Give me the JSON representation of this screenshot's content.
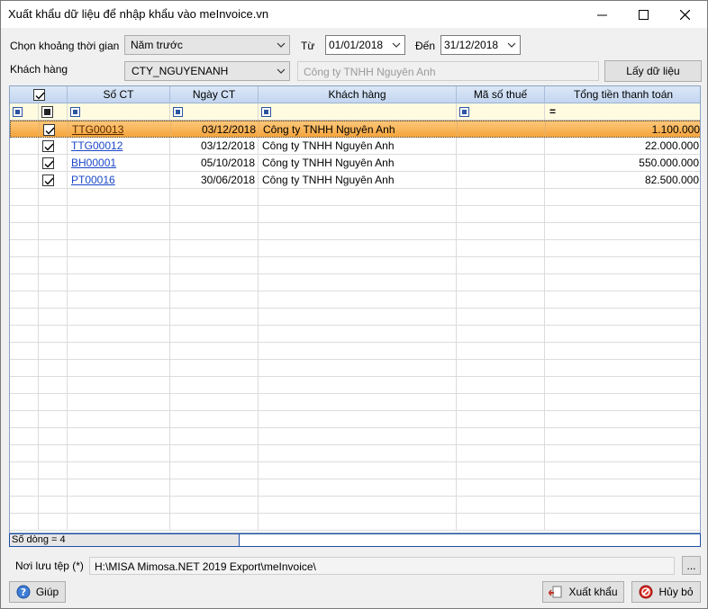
{
  "window": {
    "title": "Xuất khẩu dữ liệu để nhập khẩu vào meInvoice.vn"
  },
  "filters": {
    "period_label": "Chọn khoảng thời gian",
    "period_value": "Năm trước",
    "from_label": "Từ",
    "from_value": "01/01/2018",
    "to_label": "Đến",
    "to_value": "31/12/2018",
    "customer_label": "Khách hàng",
    "customer_code": "CTY_NGUYENANH",
    "customer_name": "Công ty TNHH Nguyên Anh",
    "fetch_button": "Lấy dữ liệu"
  },
  "grid": {
    "columns": [
      "Số CT",
      "Ngày CT",
      "Khách hàng",
      "Mã số thuế",
      "Tổng tiền thanh toán"
    ],
    "amount_filter_symbol": "=",
    "rows": [
      {
        "doc": "TTG00013",
        "date": "03/12/2018",
        "customer": "Công ty TNHH Nguyên Anh",
        "tax": "",
        "total": "1.100.000",
        "checked": true,
        "selected": true
      },
      {
        "doc": "TTG00012",
        "date": "03/12/2018",
        "customer": "Công ty TNHH Nguyên Anh",
        "tax": "",
        "total": "22.000.000",
        "checked": true,
        "selected": false
      },
      {
        "doc": "BH00001",
        "date": "05/10/2018",
        "customer": "Công ty TNHH Nguyên Anh",
        "tax": "",
        "total": "550.000.000",
        "checked": true,
        "selected": false
      },
      {
        "doc": "PT00016",
        "date": "30/06/2018",
        "customer": "Công ty TNHH Nguyên Anh",
        "tax": "",
        "total": "82.500.000",
        "checked": true,
        "selected": false
      }
    ]
  },
  "status": {
    "row_count": "Số dòng = 4"
  },
  "save": {
    "label": "Nơi lưu tệp (*)",
    "path": "H:\\MISA Mimosa.NET 2019 Export\\meInvoice\\",
    "browse": "..."
  },
  "buttons": {
    "help": "Giúp",
    "export": "Xuất khẩu",
    "cancel": "Hủy bỏ"
  },
  "colors": {
    "selected_row": "#f5a43c",
    "link": "#1a47c8",
    "header": "#c3d6f0"
  }
}
